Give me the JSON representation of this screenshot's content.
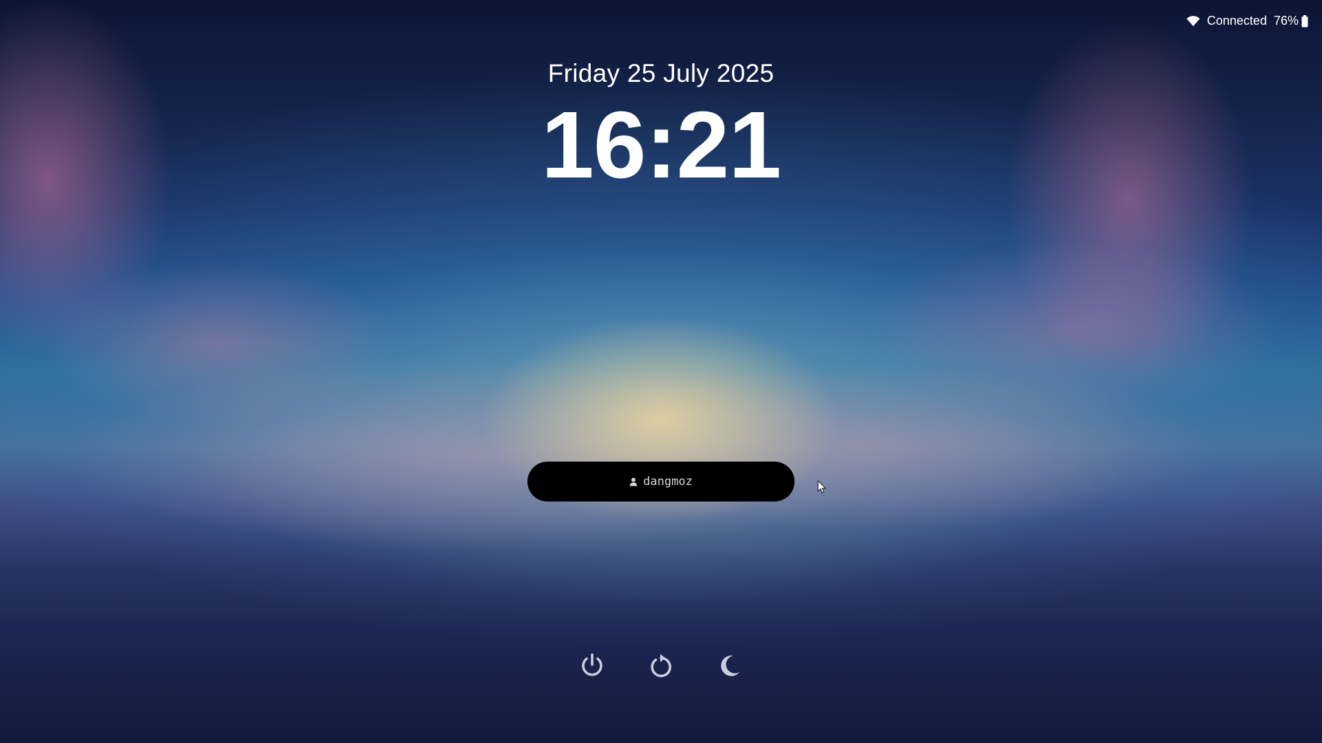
{
  "status_bar": {
    "network_status": "Connected",
    "battery_level": "76%",
    "network_icon": "wifi-icon",
    "battery_icon": "battery-icon"
  },
  "clock": {
    "date": "Friday 25 July 2025",
    "time": "16:21"
  },
  "user": {
    "icon": "user-icon",
    "username": "dangmoz"
  },
  "actions": [
    {
      "name": "shutdown",
      "icon": "power-icon"
    },
    {
      "name": "reboot",
      "icon": "restart-icon"
    },
    {
      "name": "suspend",
      "icon": "moon-icon"
    }
  ],
  "colors": {
    "pill_background": "#000000",
    "text": "#ffffff",
    "icon_muted": "#c9cede"
  }
}
